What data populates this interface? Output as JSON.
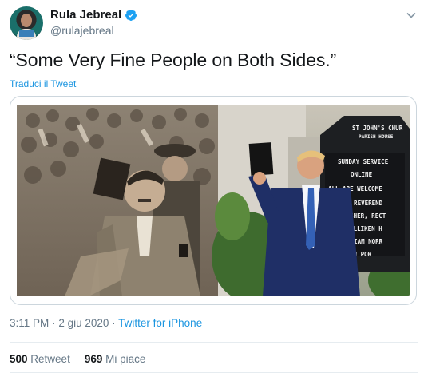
{
  "author": {
    "display_name": "Rula Jebreal",
    "handle": "@rulajebreal",
    "verified": true
  },
  "tweet": {
    "text": "“Some Very Fine People on Both Sides.”",
    "translate_label": "Traduci il Tweet"
  },
  "media": {
    "sign_lines": [
      "ST JOHN'S CHUR",
      "PARISH HOUSE",
      "SUNDAY SERVICE",
      "ONLINE",
      "ALL ARE WELCOME",
      "THE REVEREND",
      "ROB FISHER, RECT",
      "JANE MILLIKEN H",
      "WILLIAM NORR",
      "SAVANNAH POR"
    ]
  },
  "meta": {
    "time": "3:11 PM",
    "date": "2 giu 2020",
    "separator": "·",
    "source": "Twitter for iPhone"
  },
  "stats": {
    "retweets_count": "500",
    "retweets_label": "Retweet",
    "likes_count": "969",
    "likes_label": "Mi piace"
  },
  "colors": {
    "link": "#1b95e0",
    "secondary_text": "#657786",
    "verified": "#1da1f2",
    "border": "#ccd6dd"
  },
  "icons": [
    "verified-badge-icon",
    "chevron-down-icon"
  ]
}
